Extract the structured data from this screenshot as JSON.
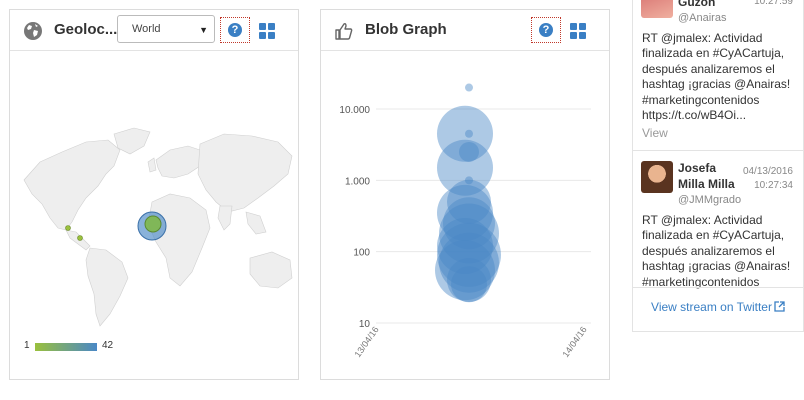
{
  "geo_panel": {
    "title": "Geoloc...",
    "region_select": "World",
    "help_label": "?",
    "legend": {
      "min": "1",
      "max": "42"
    },
    "colors": {
      "min": "#9ac03d",
      "max": "#4a88c6"
    }
  },
  "blob_panel": {
    "title": "Blob Graph",
    "help_label": "?",
    "y_ticks": [
      "10.000",
      "1.000",
      "100",
      "10"
    ],
    "x_ticks": [
      "13/04/16",
      "14/04/16"
    ]
  },
  "chart_data": {
    "type": "scatter",
    "title": "",
    "xlabel": "",
    "ylabel": "",
    "y_scale": "log",
    "ylim": [
      10,
      20000
    ],
    "x_ticks": [
      "13/04/16",
      "14/04/16"
    ],
    "color": "#4a88c6",
    "points": [
      {
        "x": "13/04/16",
        "y": 20000,
        "r": 4
      },
      {
        "x": "13/04/16",
        "y": 4500,
        "r": 28
      },
      {
        "x": "13/04/16",
        "y": 4500,
        "r": 4
      },
      {
        "x": "13/04/16",
        "y": 2500,
        "r": 10
      },
      {
        "x": "13/04/16",
        "y": 1500,
        "r": 28
      },
      {
        "x": "13/04/16",
        "y": 1000,
        "r": 4
      },
      {
        "x": "13/04/16",
        "y": 500,
        "r": 22
      },
      {
        "x": "13/04/16",
        "y": 350,
        "r": 28
      },
      {
        "x": "13/04/16",
        "y": 250,
        "r": 26
      },
      {
        "x": "13/04/16",
        "y": 180,
        "r": 30
      },
      {
        "x": "13/04/16",
        "y": 120,
        "r": 28
      },
      {
        "x": "13/04/16",
        "y": 90,
        "r": 32
      },
      {
        "x": "13/04/16",
        "y": 70,
        "r": 30
      },
      {
        "x": "13/04/16",
        "y": 55,
        "r": 30
      },
      {
        "x": "13/04/16",
        "y": 40,
        "r": 22
      },
      {
        "x": "13/04/16",
        "y": 35,
        "r": 18
      }
    ]
  },
  "tweets": [
    {
      "name_line1": "Guzón",
      "name_line2": "",
      "handle": "@Anairas",
      "date": "",
      "time": "10:27:59",
      "text_lines": [
        "RT @jmalex: Actividad",
        "finalizada en #CyACartuja,",
        "después analizaremos el",
        "hashtag ¡gracias @Anairas!",
        "#marketingcontenidos",
        "https://t.co/wB4Oi..."
      ],
      "view": "View"
    },
    {
      "name_line1": "Josefa",
      "name_line2": "Milla Milla",
      "handle": "@JMMgrado",
      "date": "04/13/2016",
      "time": "10:27:34",
      "text_lines": [
        "RT @jmalex: Actividad",
        "finalizada en #CyACartuja,",
        "después analizaremos el",
        "hashtag ¡gracias @Anairas!",
        "#marketingcontenidos"
      ]
    }
  ],
  "stream_link": "View stream on Twitter"
}
